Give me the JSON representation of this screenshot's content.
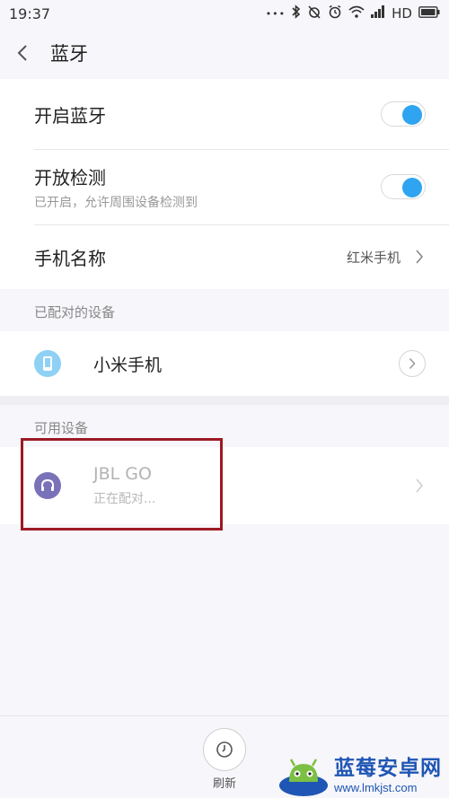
{
  "status_bar": {
    "time": "19:37",
    "more": "•••",
    "network": "HD"
  },
  "header": {
    "title": "蓝牙"
  },
  "settings": {
    "bluetooth_toggle": {
      "label": "开启蓝牙",
      "enabled": true
    },
    "discoverable_toggle": {
      "label": "开放检测",
      "sublabel": "已开启，允许周围设备检测到",
      "enabled": true
    },
    "device_name": {
      "label": "手机名称",
      "value": "红米手机"
    }
  },
  "paired_section": {
    "header": "已配对的设备",
    "devices": [
      {
        "name": "小米手机",
        "icon": "phone-icon"
      }
    ]
  },
  "available_section": {
    "header": "可用设备",
    "devices": [
      {
        "name": "JBL GO",
        "status": "正在配对...",
        "icon": "headphones-icon"
      }
    ]
  },
  "bottom": {
    "refresh_label": "刷新"
  },
  "watermark": {
    "title": "蓝莓安卓网",
    "url": "www.lmkjst.com"
  },
  "colors": {
    "accent": "#2fa4f0",
    "highlight_border": "#9b1a24",
    "watermark": "#1f56b5"
  }
}
